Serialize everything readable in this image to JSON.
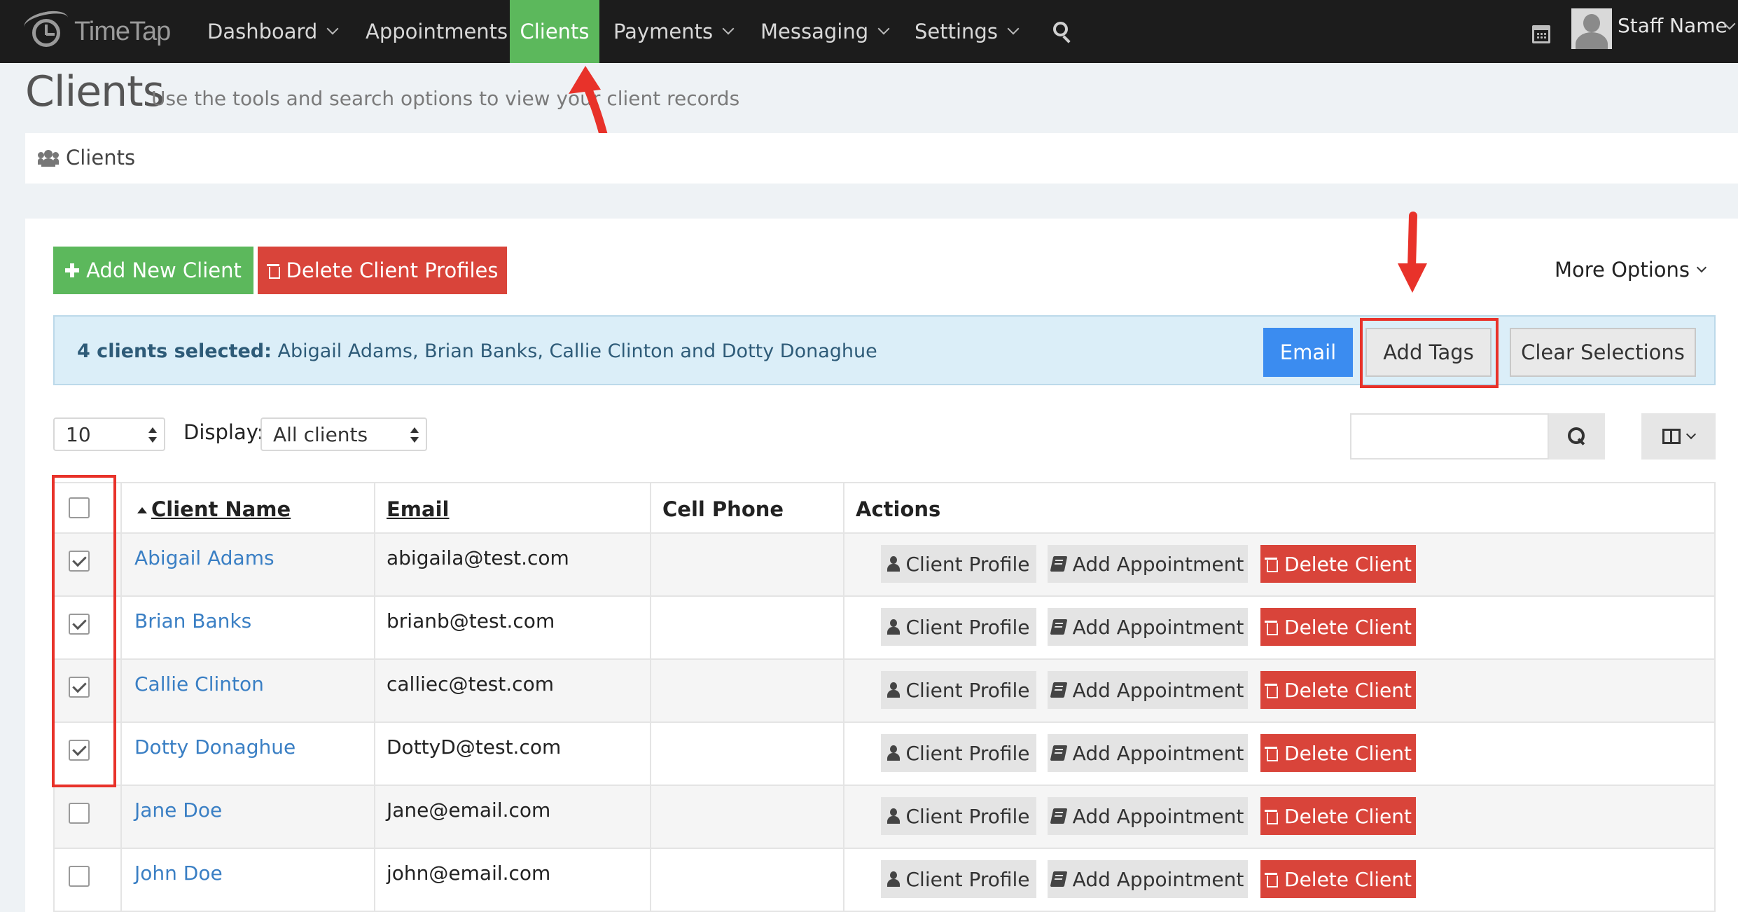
{
  "app": {
    "logo_text": "TimeTap"
  },
  "nav": {
    "items": [
      {
        "label": "Dashboard",
        "dropdown": true
      },
      {
        "label": "Appointments",
        "dropdown": false
      },
      {
        "label": "Clients",
        "dropdown": false,
        "active": true
      },
      {
        "label": "Payments",
        "dropdown": true
      },
      {
        "label": "Messaging",
        "dropdown": true
      },
      {
        "label": "Settings",
        "dropdown": true
      }
    ],
    "user_name": "Staff Name"
  },
  "header": {
    "title": "Clients",
    "subtitle": "Use the tools and search options to view your client records"
  },
  "breadcrumb": {
    "label": "Clients"
  },
  "toolbar": {
    "add_new_client": "Add New Client",
    "delete_client_profiles": "Delete Client Profiles",
    "more_options": "More Options"
  },
  "selection": {
    "count_label": "4 clients selected:",
    "names": "Abigail Adams, Brian Banks, Callie Clinton and Dotty Donaghue",
    "email_button": "Email",
    "add_tags_button": "Add Tags",
    "clear_button": "Clear Selections"
  },
  "filters": {
    "page_size": "10",
    "display_label": "Display:",
    "display_value": "All clients"
  },
  "table": {
    "headers": {
      "client_name": "Client Name",
      "email": "Email",
      "cell_phone": "Cell Phone",
      "actions": "Actions"
    },
    "action_labels": {
      "profile": "Client Profile",
      "add_appointment": "Add Appointment",
      "delete": "Delete Client"
    },
    "rows": [
      {
        "name": "Abigail Adams",
        "email": "abigaila@test.com",
        "phone": "",
        "checked": true
      },
      {
        "name": "Brian Banks",
        "email": "brianb@test.com",
        "phone": "",
        "checked": true
      },
      {
        "name": "Callie Clinton",
        "email": "calliec@test.com",
        "phone": "",
        "checked": true
      },
      {
        "name": "Dotty Donaghue",
        "email": "DottyD@test.com",
        "phone": "",
        "checked": true
      },
      {
        "name": "Jane Doe",
        "email": "Jane@email.com",
        "phone": "",
        "checked": false
      },
      {
        "name": "John Doe",
        "email": "john@email.com",
        "phone": "",
        "checked": false
      }
    ]
  },
  "colors": {
    "navbar": "#1c1c1c",
    "active_tab": "#5cb85c",
    "danger": "#d9443a",
    "primary": "#3b8cf0",
    "link": "#3a7fc4",
    "annotation": "#e8322a"
  }
}
